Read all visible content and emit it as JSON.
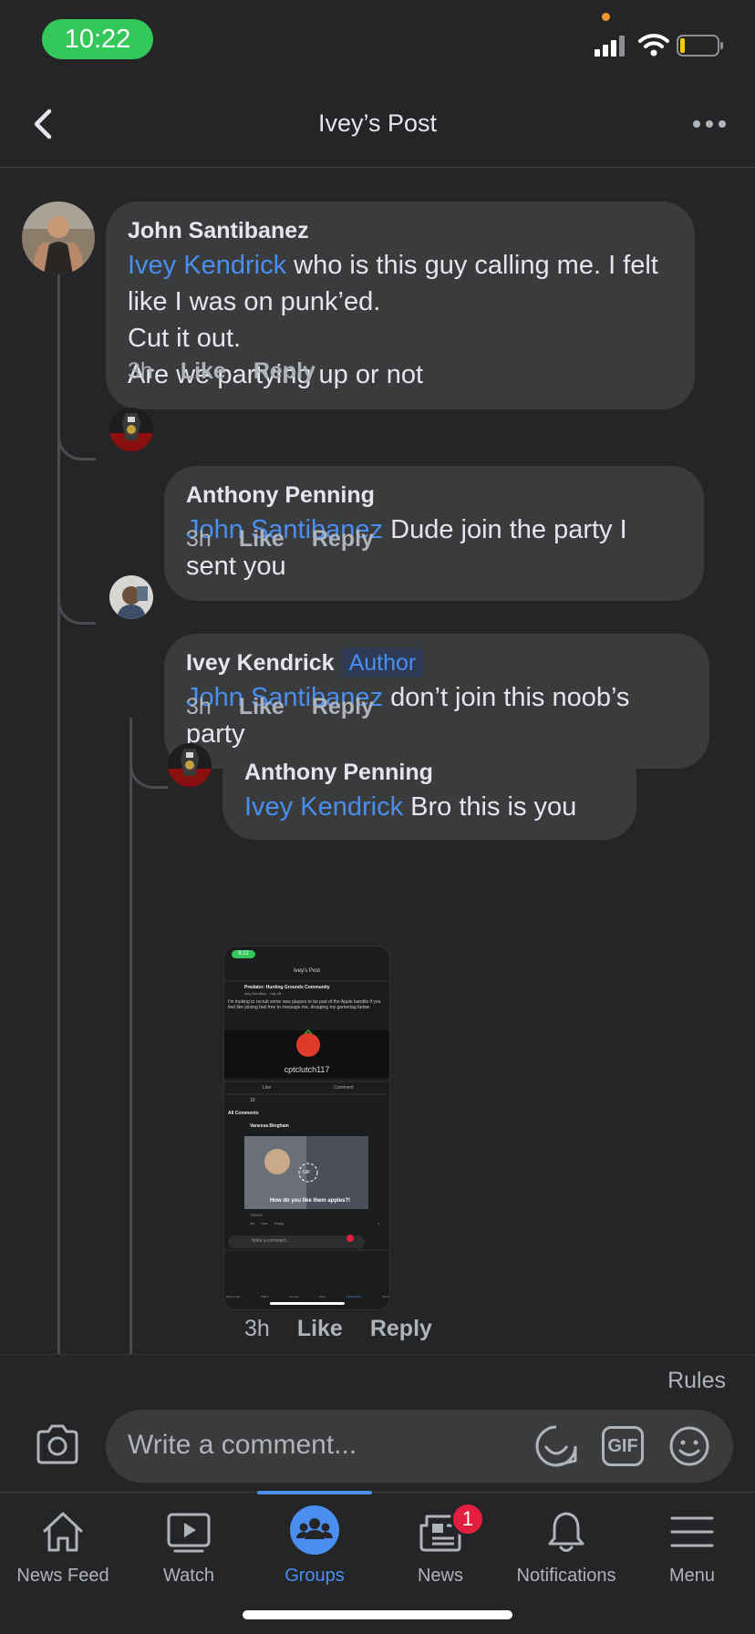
{
  "status_bar": {
    "time": "10:22"
  },
  "header": {
    "title": "Ivey’s Post"
  },
  "comments": [
    {
      "name": "John Santibanez",
      "mention": "Ivey Kendrick",
      "text": " who is this guy calling me. I felt like I was on punk’ed.\nCut it out.\nAre we partying up or not",
      "time": "3h",
      "like": "Like",
      "reply": "Reply"
    },
    {
      "name": "Anthony Penning",
      "mention": "John Santibanez",
      "text": " Dude join the party I sent you",
      "time": "3h",
      "like": "Like",
      "reply": "Reply"
    },
    {
      "name": "Ivey Kendrick",
      "badge": "Author",
      "mention": "John Santibanez",
      "text": " don’t join this noob’s party",
      "time": "3h",
      "like": "Like",
      "reply": "Reply"
    },
    {
      "name": "Anthony Penning",
      "mention": "Ivey Kendrick",
      "text": " Bro this is you",
      "time": "3h",
      "like": "Like",
      "reply": "Reply"
    }
  ],
  "attachment": {
    "status_time": "9:22",
    "title": "Ivey's Post",
    "group": "Predator: Hunting Grounds Community",
    "byline": "Ivey Kendrick · July 18 · ",
    "body": "I'm looking to recruit some new players to be part of the Apple bandits if you feel like joining feel free to message me, dropping my gamertag below",
    "gamertag": "cptclutch117",
    "like": "Like",
    "comment": "Comment",
    "reaction_count": "10",
    "all_comments": "All Comments",
    "commenter": "Vanessa Bingham",
    "gif_caption": "How do you like them apples?!",
    "gif_label": "GIF",
    "gif_source": "TENOR",
    "comment_time": "4w",
    "placeholder": "Write a comment...",
    "reply_like": "Like",
    "reply_reply": "Reply",
    "reaction_small": "1",
    "tabs": [
      "News Feed",
      "Watch",
      "Groups",
      "News",
      "Notifications",
      "Menu"
    ]
  },
  "composer": {
    "rules": "Rules",
    "placeholder": "Write a comment...",
    "gif_label": "GIF"
  },
  "tabbar": {
    "items": [
      {
        "label": "News Feed",
        "icon": "home-icon"
      },
      {
        "label": "Watch",
        "icon": "watch-icon"
      },
      {
        "label": "Groups",
        "icon": "groups-icon",
        "active": true
      },
      {
        "label": "News",
        "icon": "news-icon",
        "badge": "1"
      },
      {
        "label": "Notifications",
        "icon": "bell-icon"
      },
      {
        "label": "Menu",
        "icon": "menu-icon"
      }
    ]
  },
  "colors": {
    "background": "#242526",
    "bubble": "#3a3b3c",
    "mention": "#4a8ff0",
    "accent": "#4a8ff0",
    "badge": "#e41e3f",
    "time_pill": "#34c759"
  }
}
